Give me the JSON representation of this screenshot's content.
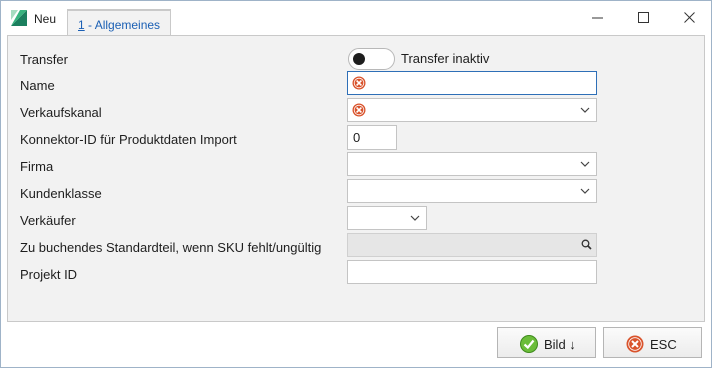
{
  "window": {
    "title": "Neu",
    "tab_number": "1",
    "tab_label": " - Allgemeines"
  },
  "form": {
    "transfer_label": "Transfer",
    "transfer_toggle_text": "Transfer inaktiv",
    "transfer_on": false,
    "name_label": "Name",
    "name_value": "",
    "verkaufskanal_label": "Verkaufskanal",
    "verkaufskanal_value": "",
    "konnektor_label": "Konnektor-ID für Produktdaten Import",
    "konnektor_value": "0",
    "firma_label": "Firma",
    "firma_value": "",
    "kundenklasse_label": "Kundenklasse",
    "kundenklasse_value": "",
    "verkaeufer_label": "Verkäufer",
    "verkaeufer_value": "",
    "standardteil_label": "Zu buchendes Standardteil, wenn SKU fehlt/ungültig",
    "standardteil_value": "",
    "projekt_label": "Projekt ID",
    "projekt_value": ""
  },
  "footer": {
    "bild_label": "Bild ↓",
    "esc_label": "ESC"
  },
  "colors": {
    "accent": "#2e6fb7",
    "error": "#d9532c",
    "ok": "#5aa82c"
  },
  "icons": [
    "app-logo-icon",
    "minimize-icon",
    "maximize-icon",
    "close-icon",
    "error-icon",
    "chevron-down-icon",
    "search-icon",
    "checkmark-icon",
    "cancel-icon"
  ]
}
